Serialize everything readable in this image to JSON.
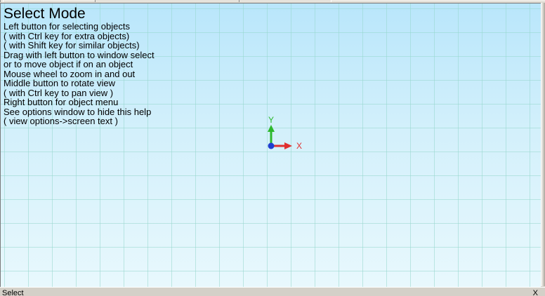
{
  "viewport": {
    "help": {
      "title": "Select Mode",
      "lines": [
        "Left button for selecting objects",
        "( with Ctrl key for extra objects)",
        "( with Shift key for similar objects)",
        "Drag with left button to window select",
        "or to move object if on an object",
        "Mouse wheel to zoom in and out",
        "Middle button to rotate view",
        "( with Ctrl key to pan view )",
        "Right button for object menu",
        "See options window to hide this help",
        "( view options->screen text )"
      ]
    },
    "axis": {
      "y_label": "Y",
      "x_label": "X",
      "y_color": "#2db82d",
      "x_color": "#e03030",
      "z_color": "#1f3fd0"
    },
    "background_top": "#b9e6fb",
    "background_bottom": "#e8f8fd",
    "grid_color": "#96d7cd"
  },
  "statusbar": {
    "text": "Select",
    "close_label": "X"
  }
}
